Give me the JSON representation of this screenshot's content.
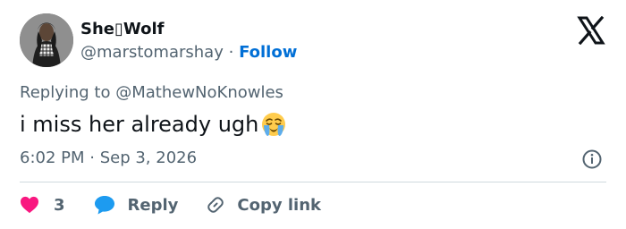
{
  "author": {
    "name": "She▯Wolf",
    "handle": "@marstomarshay",
    "separator": "·",
    "follow_label": "Follow"
  },
  "reply_context": {
    "prefix": "Replying to",
    "mention": "@MathewNoKnowles"
  },
  "tweet": {
    "text": "i miss her already ugh",
    "emoji": "loudly-crying-face"
  },
  "meta": {
    "timestamp": "6:02 PM · Sep 3, 2026"
  },
  "actions": {
    "like_count": "3",
    "reply_label": "Reply",
    "copy_link_label": "Copy link"
  },
  "colors": {
    "accent": "#006fd6",
    "like": "#f91880",
    "reply": "#1d9bf0",
    "muted": "#536471",
    "text": "#0f1419"
  },
  "icons": [
    "x-logo-icon",
    "info-icon",
    "heart-icon",
    "reply-bubble-icon",
    "link-icon"
  ]
}
